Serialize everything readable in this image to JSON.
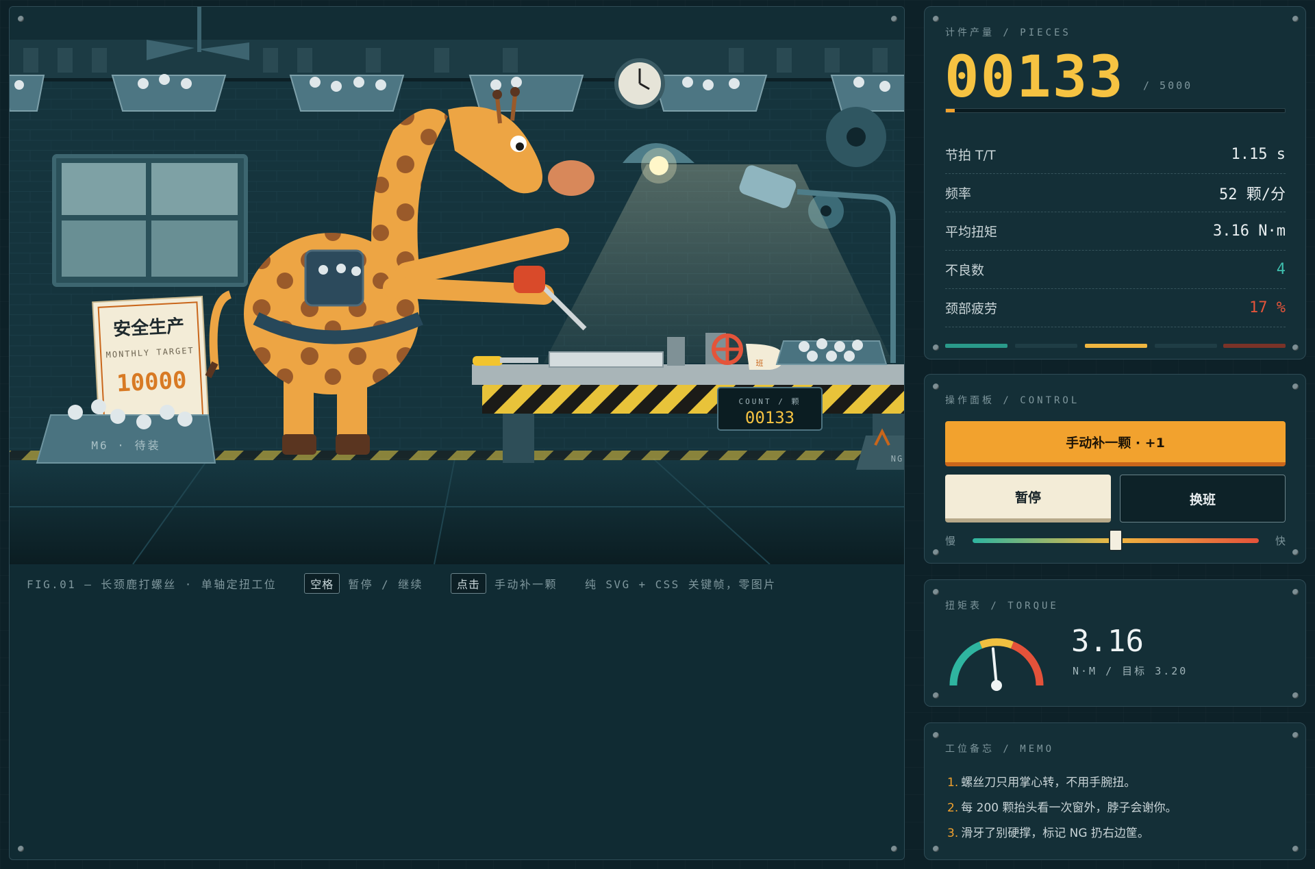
{
  "stage": {
    "figure_caption": "FIG.01 — 长颈鹿打螺丝 · 单轴定扭工位",
    "hint_space_key": "空格",
    "hint_space_action": "暂停 / 继续",
    "hint_click_key": "点击",
    "hint_click_action": "手动补一颗",
    "tech_note": "纯 SVG + CSS 关键帧，零图片"
  },
  "scene": {
    "poster_title": "安全生产",
    "poster_subtitle": "MONTHLY TARGET",
    "poster_value": "10000",
    "bin_label": "M6 · 待装",
    "counter_label": "COUNT / 颗",
    "counter_value": "00133",
    "mug_label": "班",
    "reject_label": "NG"
  },
  "stats": {
    "title": "计件产量 / PIECES",
    "count": "00133",
    "target_text": "/ 5000",
    "progress": 0.0266,
    "rows": [
      {
        "label": "节拍 T/T",
        "value": "1.15 s"
      },
      {
        "label": "频率",
        "value": "52 颗/分"
      },
      {
        "label": "平均扭矩",
        "value": "3.16 N·m"
      },
      {
        "label": "不良数",
        "value": "4"
      },
      {
        "label": "颈部疲劳",
        "value": "17 %"
      }
    ]
  },
  "control": {
    "title": "操作面板 / CONTROL",
    "add_label": "手动补一颗 · +1",
    "pause_label": "暂停",
    "shift_label": "换班",
    "slow_label": "慢",
    "fast_label": "快",
    "speed": 0.5
  },
  "torque": {
    "title": "扭矩表 / TORQUE",
    "value": "3.16",
    "unit_text": "N·M / 目标 3.20",
    "gauge_fraction": 0.47
  },
  "memo": {
    "title": "工位备忘 / MEMO",
    "items": [
      {
        "num": "1.",
        "text": "螺丝刀只用掌心转，不用手腕扭。"
      },
      {
        "num": "2.",
        "text": "每 200 颗抬头看一次窗外，脖子会谢你。"
      },
      {
        "num": "3.",
        "text": "滑牙了别硬撑，标记 NG 扔右边筐。"
      }
    ]
  },
  "colors": {
    "accent": "#f2a22e",
    "count_yellow": "#f6c342",
    "teal": "#3fbfae",
    "danger": "#e4543a"
  }
}
